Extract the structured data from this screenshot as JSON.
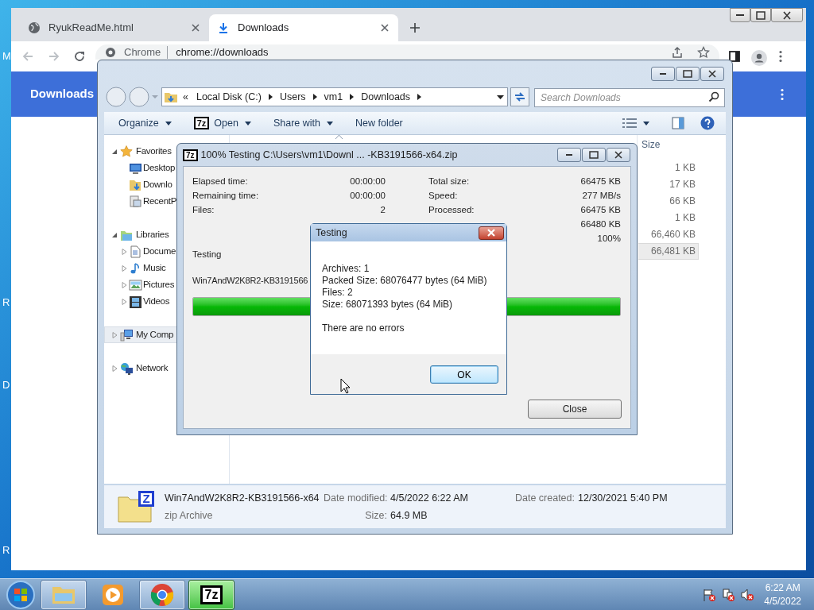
{
  "desktop": {
    "icon_labels": [
      "M",
      "R",
      "D",
      "R"
    ]
  },
  "chrome": {
    "tabs": [
      {
        "title": "RyukReadMe.html",
        "selected": false
      },
      {
        "title": "Downloads",
        "selected": true
      }
    ],
    "omnibox": {
      "site": "Chrome",
      "url": "chrome://downloads"
    },
    "page_title": "Downloads"
  },
  "explorer": {
    "breadcrumb_overflow": "«",
    "path": [
      "Local Disk (C:)",
      "Users",
      "vm1",
      "Downloads"
    ],
    "search": {
      "placeholder": "Search Downloads"
    },
    "toolbar": [
      {
        "label": "Organize",
        "kind": "menu"
      },
      {
        "label": "Open",
        "kind": "app_menu",
        "icon_text": "7z"
      },
      {
        "label": "Share with",
        "kind": "menu"
      },
      {
        "label": "New folder",
        "kind": "command"
      }
    ],
    "nav": [
      {
        "label": "Favorites",
        "expanded": true,
        "selected": false,
        "children": [
          {
            "label": "Desktop",
            "selected": false
          },
          {
            "label": "Downlo",
            "selected": false
          },
          {
            "label": "RecentP",
            "selected": false
          }
        ]
      },
      {
        "label": "Libraries",
        "expanded": true,
        "selected": false,
        "children": [
          {
            "label": "Docume",
            "expanded": false,
            "selected": false
          },
          {
            "label": "Music",
            "expanded": false,
            "selected": false
          },
          {
            "label": "Pictures",
            "expanded": false,
            "selected": false
          },
          {
            "label": "Videos",
            "expanded": false,
            "selected": false
          }
        ]
      },
      {
        "label": "My Comp",
        "expanded": false,
        "selected": true
      },
      {
        "label": "Network",
        "expanded": false,
        "selected": false
      }
    ],
    "size_header": "Size",
    "size_rows": [
      {
        "size": "1 KB",
        "selected": false
      },
      {
        "size": "17 KB",
        "selected": false
      },
      {
        "size": "66 KB",
        "selected": false
      },
      {
        "size": "1 KB",
        "selected": false
      },
      {
        "size": "66,460 KB",
        "selected": false
      },
      {
        "size": "66,481 KB",
        "selected": true
      }
    ],
    "details": {
      "icon_text": "Z",
      "name": "Win7AndW2K8R2-KB3191566-x64",
      "type": "zip Archive",
      "properties": [
        {
          "label": "Date modified:",
          "value": "4/5/2022 6:22 AM"
        },
        {
          "label": "Size:",
          "value": "64.9 MB"
        },
        {
          "label": "Date created:",
          "value": "12/30/2021 5:40 PM"
        }
      ]
    }
  },
  "sevenzip": {
    "icon_text": "7z",
    "title": "100% Testing C:\\Users\\vm1\\Downl ... -KB3191566-x64.zip",
    "left_stats": [
      {
        "label": "Elapsed time:",
        "value": "00:00:00"
      },
      {
        "label": "Remaining time:",
        "value": "00:00:00"
      },
      {
        "label": "Files:",
        "value": "2"
      }
    ],
    "right_stats": [
      {
        "label": "Total size:",
        "value": "66475 KB"
      },
      {
        "label": "Speed:",
        "value": "277 MB/s"
      },
      {
        "label": "Processed:",
        "value": "66475 KB"
      },
      {
        "value": "66480 KB"
      },
      {
        "value": "100%"
      }
    ],
    "status": "Testing",
    "file": "Win7AndW2K8R2-KB3191566",
    "progress": {
      "level": 1
    },
    "close_button": "Close"
  },
  "dialog": {
    "title": "Testing",
    "lines": [
      "Archives: 1",
      "Packed Size: 68076477 bytes (64 MiB)",
      "Files: 2",
      "Size: 68071393 bytes (64 MiB)"
    ],
    "message": "There are no errors",
    "ok_button": "OK"
  },
  "taskbar": {
    "apps": [
      {
        "kind": "explorer",
        "running": true,
        "active": false
      },
      {
        "kind": "media_player",
        "running": false,
        "active": false
      },
      {
        "kind": "chrome",
        "running": true,
        "active": false
      },
      {
        "kind": "sevenzip",
        "running": true,
        "active": true,
        "icon_text": "7z"
      }
    ],
    "clock": {
      "time": "6:22 AM",
      "date": "4/5/2022"
    }
  }
}
